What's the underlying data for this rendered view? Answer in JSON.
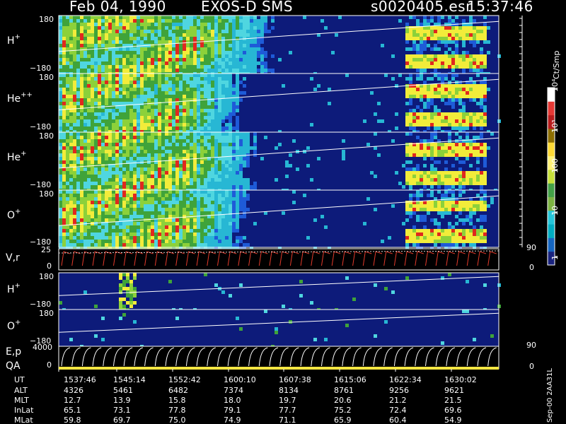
{
  "header": {
    "date": "Feb 04, 1990",
    "instrument": "EXOS-D SMS",
    "file": "s0020405.esr",
    "time": "15:37:46"
  },
  "side_text": {
    "unit": "Ct/Smp",
    "footer": "Sep-00  2AA31L"
  },
  "colorbar": {
    "ticks": [
      "1",
      "10",
      "100",
      "10³",
      "10⁴"
    ],
    "colors": [
      "#1a237e",
      "#1565c0",
      "#00acc1",
      "#26c6da",
      "#7cb342",
      "#43a047",
      "#c6e03a",
      "#fff176",
      "#fdd835",
      "#8d6e00",
      "#b71c1c",
      "#e53935",
      "#ffffff"
    ]
  },
  "panels": [
    {
      "id": "hplus",
      "species": "H",
      "charge": "+",
      "ymax": "180",
      "ymin": "−180"
    },
    {
      "id": "hepp",
      "species": "He",
      "charge": "++",
      "ymax": "180",
      "ymin": "−180"
    },
    {
      "id": "heplus",
      "species": "He",
      "charge": "+",
      "ymax": "180",
      "ymin": "−180"
    },
    {
      "id": "oplus",
      "species": "O",
      "charge": "+",
      "ymax": "180",
      "ymin": "−180"
    }
  ],
  "vr_panel": {
    "label": "V,r",
    "ytop": "25",
    "ybot": "0",
    "rtop": "90",
    "rbot": "0"
  },
  "small_panels": [
    {
      "id": "hplus2",
      "species": "H",
      "charge": "+",
      "ymax": "180",
      "ymin": "−180"
    },
    {
      "id": "oplus2",
      "species": "O",
      "charge": "+",
      "ymax": "180",
      "ymin": "−180"
    }
  ],
  "ep_panel": {
    "label1": "E,p",
    "label2": "QA",
    "ytop": "4000",
    "ybot": "0",
    "rtop": "90",
    "rbot": "0"
  },
  "table": {
    "rows": [
      {
        "label": "UT",
        "values": [
          "1537:46",
          "1545:14",
          "1552:42",
          "1600:10",
          "1607:38",
          "1615:06",
          "1622:34",
          "1630:02"
        ]
      },
      {
        "label": "ALT",
        "values": [
          "4326",
          "5461",
          "6482",
          "7374",
          "8134",
          "8761",
          "9256",
          "9621"
        ]
      },
      {
        "label": "MLT",
        "values": [
          "12.7",
          "13.9",
          "15.8",
          "18.0",
          "19.7",
          "20.6",
          "21.2",
          "21.5"
        ]
      },
      {
        "label": "InLat",
        "values": [
          "65.1",
          "73.1",
          "77.8",
          "79.1",
          "77.7",
          "75.2",
          "72.4",
          "69.6"
        ]
      },
      {
        "label": "MLat",
        "values": [
          "59.8",
          "69.7",
          "75.0",
          "74.9",
          "71.1",
          "65.9",
          "60.4",
          "54.9"
        ]
      }
    ]
  },
  "chart_data": {
    "type": "heatmap",
    "x_tick_labels": [
      "1537:46",
      "1545:14",
      "1552:42",
      "1600:10",
      "1607:38",
      "1615:06",
      "1622:34",
      "1630:02"
    ],
    "panels": [
      "H+",
      "He++",
      "He+",
      "O+",
      "V,r",
      "H+",
      "O+",
      "E,p"
    ],
    "colorbar_unit": "Ct/Smp",
    "colorbar_ticks": [
      "1",
      "10",
      "100",
      "10³",
      "10⁴"
    ]
  }
}
